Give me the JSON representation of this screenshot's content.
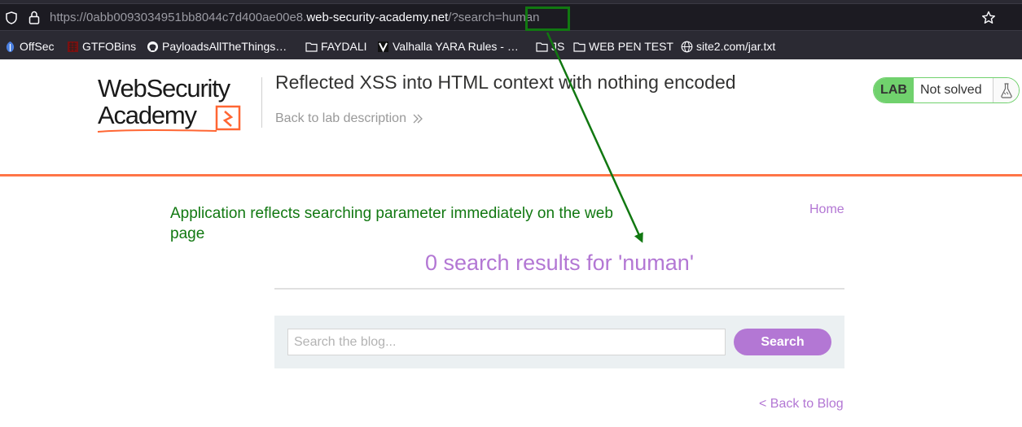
{
  "browser": {
    "url_prefix": "https://0abb0093034951bb8044c7d400ae00e8.",
    "url_domain": "web-security-academy.net",
    "url_suffix": "/?search=human",
    "bookmarks": [
      {
        "label": "OffSec",
        "icon": "offsec-icon"
      },
      {
        "label": "GTFOBins",
        "icon": "gtfobins-icon"
      },
      {
        "label": "PayloadsAllTheThings…",
        "icon": "github-icon"
      },
      {
        "label": "FAYDALI",
        "icon": "folder-icon"
      },
      {
        "label": "Valhalla YARA Rules - …",
        "icon": "valhalla-icon"
      },
      {
        "label": "JS",
        "icon": "folder-icon"
      },
      {
        "label": "WEB PEN TEST",
        "icon": "folder-icon"
      },
      {
        "label": "site2.com/jar.txt",
        "icon": "globe-icon"
      }
    ]
  },
  "header": {
    "logo_line1": "WebSecurity",
    "logo_line2": "Academy",
    "lab_title": "Reflected XSS into HTML context with nothing encoded",
    "back_link": "Back to lab description",
    "lab_badge": "LAB",
    "lab_state": "Not solved"
  },
  "main": {
    "annotation": "Application reflects searching parameter immediately on the web page",
    "home_link": "Home",
    "results_title": "0 search results for 'numan'",
    "search_placeholder": "Search the blog...",
    "search_button": "Search",
    "back_to_blog": "< Back to Blog"
  },
  "colors": {
    "accent": "#b377d4",
    "brand_orange": "#ff6633",
    "lab_green": "#70d16d",
    "annotation_green": "#117811"
  }
}
